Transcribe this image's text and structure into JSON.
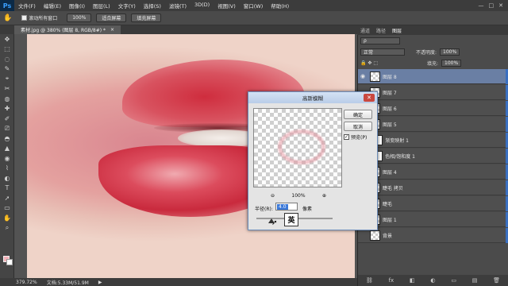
{
  "app": {
    "logo": "Ps"
  },
  "menu": [
    "文件(F)",
    "编辑(E)",
    "图像(I)",
    "图层(L)",
    "文字(Y)",
    "选择(S)",
    "滤镜(T)",
    "3D(D)",
    "视图(V)",
    "窗口(W)",
    "帮助(H)"
  ],
  "window_controls": {
    "minimize": "—",
    "maximize": "□",
    "close": "✕"
  },
  "options_bar": {
    "scroll_all_windows": "滚动所有窗口",
    "zoom_100": "100%",
    "fit_screen": "适合屏幕",
    "fill_screen": "填充屏幕"
  },
  "document": {
    "tab_title": "素材.jpg @ 380% (图层 8, RGB/8#) *",
    "tab_close": "×"
  },
  "tools": [
    "✥",
    "⬚",
    "◌",
    "✎",
    "⌖",
    "✂",
    "◍",
    "✚",
    "✐",
    "⎚",
    "◓",
    "▲",
    "◉",
    "⌇",
    "◐",
    "T",
    "➚",
    "▭",
    "✋",
    "⌕"
  ],
  "status": {
    "zoom": "379.72%",
    "doc": "文档:5.33M/51.9M",
    "arrow": "▶"
  },
  "panel": {
    "tabs": [
      "通道",
      "路径",
      "图层"
    ],
    "blend_mode": "正常",
    "opacity_label": "不透明度:",
    "opacity": "100%",
    "fill_label": "填充:",
    "fill": "100%",
    "layers": [
      {
        "name": "图层 8",
        "selected": true,
        "type": "pixel"
      },
      {
        "name": "图层 7",
        "selected": false,
        "type": "pixel"
      },
      {
        "name": "图层 6",
        "selected": false,
        "type": "pixel"
      },
      {
        "name": "图层 5",
        "selected": false,
        "type": "pixel"
      },
      {
        "name": "渐变映射 1",
        "selected": false,
        "type": "adjust"
      },
      {
        "name": "色相/饱和度 1",
        "selected": false,
        "type": "adjust"
      },
      {
        "name": "图层 4",
        "selected": false,
        "type": "pixel"
      },
      {
        "name": "睫毛 拷贝",
        "selected": false,
        "type": "pixel"
      },
      {
        "name": "睫毛",
        "selected": false,
        "type": "pixel"
      },
      {
        "name": "图层 1",
        "selected": false,
        "type": "pixel"
      },
      {
        "name": "背景",
        "selected": false,
        "type": "pixel"
      }
    ],
    "footer_icons": [
      "⛓",
      "fx",
      "◧",
      "◐",
      "▭",
      "▤",
      "🗑"
    ]
  },
  "dialog": {
    "title": "高斯模糊",
    "close": "✕",
    "ok": "确定",
    "cancel": "取消",
    "preview_label": "预览(P)",
    "preview_checked": "✓",
    "zoom_out": "⊖",
    "zoom_level": "100%",
    "zoom_in": "⊕",
    "radius_label": "半径(R):",
    "radius_value": "4.0",
    "radius_unit": "像素",
    "radius_slider_fraction": 0.2
  },
  "ime_indicator": "英"
}
